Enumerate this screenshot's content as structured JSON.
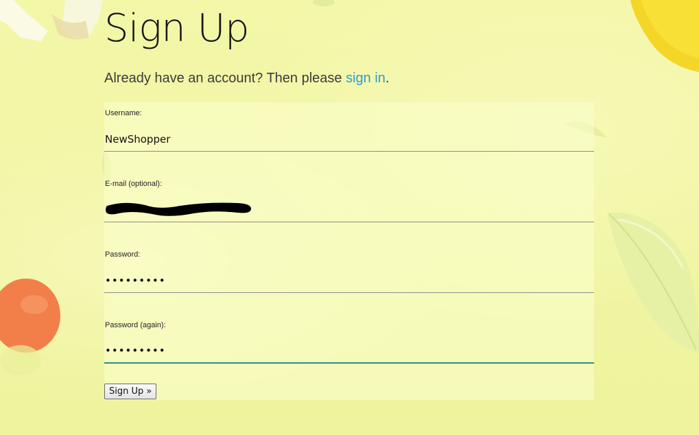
{
  "page": {
    "title": "Sign Up",
    "signin_prompt_before": "Already have an account? Then please ",
    "signin_link": "sign in",
    "signin_prompt_after": "."
  },
  "form": {
    "username": {
      "label": "Username:",
      "value": "NewShopper"
    },
    "email": {
      "label": "E-mail (optional):",
      "value": ""
    },
    "password": {
      "label": "Password:",
      "value": "•••••••••"
    },
    "password_again": {
      "label": "Password (again):",
      "value": "•••••••••"
    },
    "submit_label": "Sign Up »"
  },
  "colors": {
    "background": "#f1f6a4",
    "link": "#2f9ccc",
    "focus_underline": "#2b8f8a",
    "text": "#161616"
  },
  "icons": [
    "napkin-decoration",
    "lemon-decoration",
    "tomato-decoration",
    "leaf-decoration"
  ]
}
